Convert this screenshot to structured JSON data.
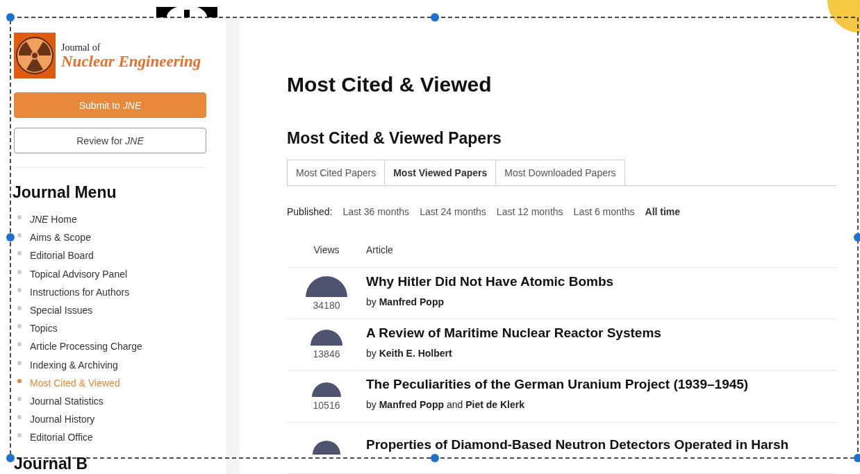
{
  "sidebar": {
    "logo": {
      "line1": "Journal of",
      "line2": "Nuclear Engineering"
    },
    "buttons": [
      {
        "label": "Submit to *JNE*",
        "kind": "primary"
      },
      {
        "label": "Review for *JNE*",
        "kind": "outline"
      }
    ],
    "menu_title": "Journal Menu",
    "menu": [
      {
        "label": "*JNE* Home",
        "selected": false
      },
      {
        "label": "Aims & Scope",
        "selected": false
      },
      {
        "label": "Editorial Board",
        "selected": false
      },
      {
        "label": "Topical Advisory Panel",
        "selected": false
      },
      {
        "label": "Instructions for Authors",
        "selected": false
      },
      {
        "label": "Special Issues",
        "selected": false
      },
      {
        "label": "Topics",
        "selected": false
      },
      {
        "label": "Article Processing Charge",
        "selected": false
      },
      {
        "label": "Indexing & Archiving",
        "selected": false
      },
      {
        "label": "Most Cited & Viewed",
        "selected": true
      },
      {
        "label": "Journal Statistics",
        "selected": false
      },
      {
        "label": "Journal History",
        "selected": false
      },
      {
        "label": "Editorial Office",
        "selected": false
      }
    ],
    "next_heading": "Journal B"
  },
  "main": {
    "title": "Most Cited & Viewed",
    "subtitle": "Most Cited & Viewed Papers",
    "tabs": [
      {
        "label": "Most Cited Papers",
        "selected": false
      },
      {
        "label": "Most Viewed Papers",
        "selected": true
      },
      {
        "label": "Most Downloaded Papers",
        "selected": false
      }
    ],
    "filter_label": "Published:",
    "filters": [
      {
        "label": "Last 36 months",
        "selected": false
      },
      {
        "label": "Last 24 months",
        "selected": false
      },
      {
        "label": "Last 12 months",
        "selected": false
      },
      {
        "label": "Last 6 months",
        "selected": false
      },
      {
        "label": "All time",
        "selected": true
      }
    ],
    "columns": [
      "Views",
      "Article"
    ],
    "rows": [
      {
        "views": "34180",
        "title": "Why Hitler Did Not Have Atomic Bombs",
        "authors": "by **Manfred Popp**"
      },
      {
        "views": "13846",
        "title": "A Review of Maritime Nuclear Reactor Systems",
        "authors": "by **Keith E. Holbert**"
      },
      {
        "views": "10516",
        "title": "The Peculiarities of the German Uranium Project (1939–1945)",
        "authors": "by **Manfred Popp** and **Piet de Klerk**"
      },
      {
        "title": "Properties of Diamond-Based Neutron Detectors Operated in Harsh"
      }
    ]
  }
}
